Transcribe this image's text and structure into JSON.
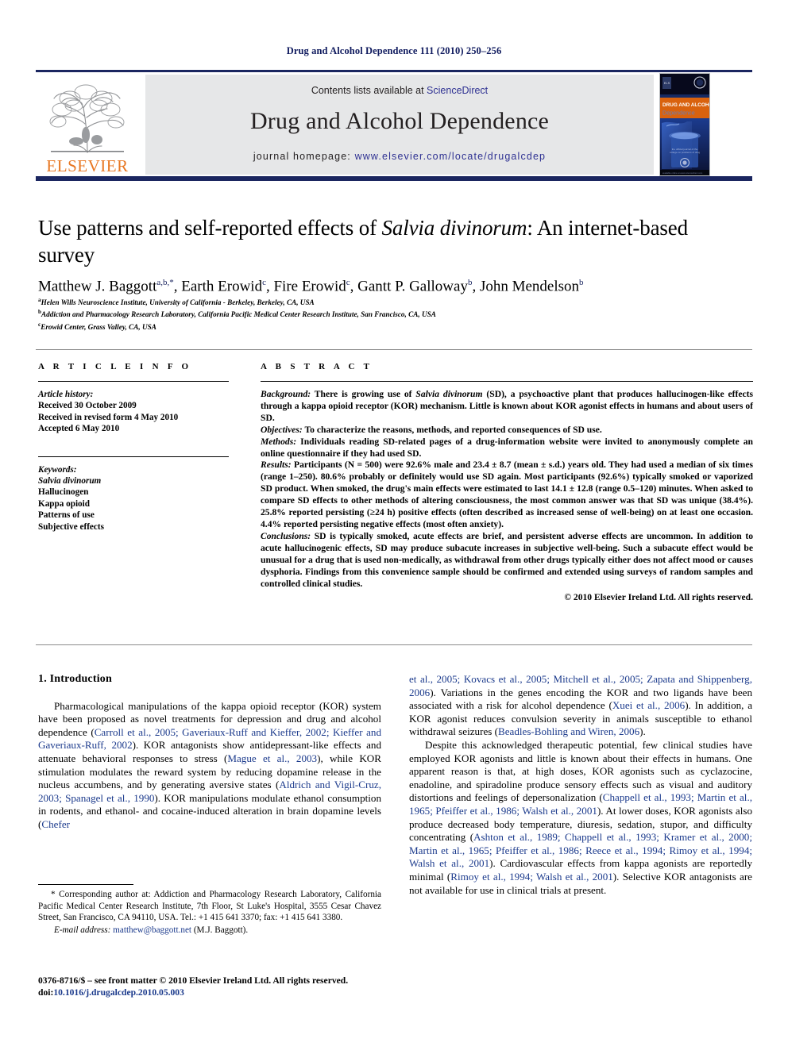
{
  "running_head": "Drug and Alcohol Dependence 111 (2010) 250–256",
  "masthead": {
    "contents_prefix": "Contents lists available at ",
    "sciencedirect": "ScienceDirect",
    "journal_name": "Drug and Alcohol Dependence",
    "homepage_prefix": "journal homepage: ",
    "homepage_url": "www.elsevier.com/locate/drugalcdep",
    "publisher": "ELSEVIER",
    "cover_title_line1": "DRUG AND ALCOHOL",
    "cover_title_line2": "Dependence",
    "accent_orange": "#e87722",
    "accent_blue": "#2e3192",
    "rule_color": "#1b2660",
    "band_bg": "#e6e7e8"
  },
  "article": {
    "title_part1": "Use patterns and self-reported effects of ",
    "title_italic": "Salvia divinorum",
    "title_part2": ": An internet-based survey",
    "authors": [
      {
        "name": "Matthew J. Baggott",
        "sup": "a,b,*"
      },
      {
        "name": "Earth Erowid",
        "sup": "c"
      },
      {
        "name": "Fire Erowid",
        "sup": "c"
      },
      {
        "name": "Gantt P. Galloway",
        "sup": "b"
      },
      {
        "name": "John Mendelson",
        "sup": "b"
      }
    ],
    "affiliations": [
      {
        "mark": "a",
        "text": "Helen Wills Neuroscience Institute, University of California - Berkeley, Berkeley, CA, USA"
      },
      {
        "mark": "b",
        "text": "Addiction and Pharmacology Research Laboratory, California Pacific Medical Center Research Institute, San Francisco, CA, USA"
      },
      {
        "mark": "c",
        "text": "Erowid Center, Grass Valley, CA, USA"
      }
    ]
  },
  "article_info": {
    "heading": "A R T I C L E   I N F O",
    "history_label": "Article history:",
    "history": [
      "Received 30 October 2009",
      "Received in revised form 4 May 2010",
      "Accepted 6 May 2010"
    ],
    "keywords_label": "Keywords:",
    "keywords": [
      "Salvia divinorum",
      "Hallucinogen",
      "Kappa opioid",
      "Patterns of use",
      "Subjective effects"
    ]
  },
  "abstract": {
    "heading": "A B S T R A C T",
    "background_label": "Background:",
    "background_text": " There is growing use of Salvia divinorum (SD), a psychoactive plant that produces hallucinogen-like effects through a kappa opioid receptor (KOR) mechanism. Little is known about KOR agonist effects in humans and about users of SD.",
    "objectives_label": "Objectives:",
    "objectives_text": " To characterize the reasons, methods, and reported consequences of SD use.",
    "methods_label": "Methods:",
    "methods_text": " Individuals reading SD-related pages of a drug-information website were invited to anonymously complete an online questionnaire if they had used SD.",
    "results_label": "Results:",
    "results_text": " Participants (N = 500) were 92.6% male and 23.4 ± 8.7 (mean ± s.d.) years old. They had used a median of six times (range 1–250). 80.6% probably or definitely would use SD again. Most participants (92.6%) typically smoked or vaporized SD product. When smoked, the drug's main effects were estimated to last 14.1 ± 12.8 (range 0.5–120) minutes. When asked to compare SD effects to other methods of altering consciousness, the most common answer was that SD was unique (38.4%). 25.8% reported persisting (≥24 h) positive effects (often described as increased sense of well-being) on at least one occasion. 4.4% reported persisting negative effects (most often anxiety).",
    "conclusions_label": "Conclusions:",
    "conclusions_text": " SD is typically smoked, acute effects are brief, and persistent adverse effects are uncommon. In addition to acute hallucinogenic effects, SD may produce subacute increases in subjective well-being. Such a subacute effect would be unusual for a drug that is used non-medically, as withdrawal from other drugs typically either does not affect mood or causes dysphoria. Findings from this convenience sample should be confirmed and extended using surveys of random samples and controlled clinical studies.",
    "copyright": "© 2010 Elsevier Ireland Ltd. All rights reserved."
  },
  "body": {
    "section_heading": "1. Introduction",
    "left_paragraph_1": {
      "segments": [
        {
          "t": "Pharmacological manipulations of the kappa opioid receptor (KOR) system have been proposed as novel treatments for depression and drug and alcohol dependence (",
          "ref": false
        },
        {
          "t": "Carroll et al., 2005; Gaveriaux-Ruff and Kieffer, 2002; Kieffer and Gaveriaux-Ruff, 2002",
          "ref": true
        },
        {
          "t": "). KOR antagonists show antidepressant-like effects and attenuate behavioral responses to stress (",
          "ref": false
        },
        {
          "t": "Mague et al., 2003",
          "ref": true
        },
        {
          "t": "), while KOR stimulation modulates the reward system by reducing dopamine release in the nucleus accumbens, and by generating aversive states (",
          "ref": false
        },
        {
          "t": "Aldrich and Vigil-Cruz, 2003; Spanagel et al., 1990",
          "ref": true
        },
        {
          "t": "). KOR manipulations modulate ethanol consumption in rodents, and ethanol- and cocaine-induced alteration in brain dopamine levels (",
          "ref": false
        },
        {
          "t": "Chefer",
          "ref": true
        }
      ]
    },
    "right_paragraph_1": {
      "segments": [
        {
          "t": "et al., 2005; Kovacs et al., 2005; Mitchell et al., 2005; Zapata and Shippenberg, 2006",
          "ref": true
        },
        {
          "t": "). Variations in the genes encoding the KOR and two ligands have been associated with a risk for alcohol dependence (",
          "ref": false
        },
        {
          "t": "Xuei et al., 2006",
          "ref": true
        },
        {
          "t": "). In addition, a KOR agonist reduces convulsion severity in animals susceptible to ethanol withdrawal seizures (",
          "ref": false
        },
        {
          "t": "Beadles-Bohling and Wiren, 2006",
          "ref": true
        },
        {
          "t": ").",
          "ref": false
        }
      ]
    },
    "right_paragraph_2": {
      "segments": [
        {
          "t": "Despite this acknowledged therapeutic potential, few clinical studies have employed KOR agonists and little is known about their effects in humans. One apparent reason is that, at high doses, KOR agonists such as cyclazocine, enadoline, and spiradoline produce sensory effects such as visual and auditory distortions and feelings of depersonalization (",
          "ref": false
        },
        {
          "t": "Chappell et al., 1993; Martin et al., 1965; Pfeiffer et al., 1986; Walsh et al., 2001",
          "ref": true
        },
        {
          "t": "). At lower doses, KOR agonists also produce decreased body temperature, diuresis, sedation, stupor, and difficulty concentrating (",
          "ref": false
        },
        {
          "t": "Ashton et al., 1989; Chappell et al., 1993; Kramer et al., 2000; Martin et al., 1965; Pfeiffer et al., 1986; Reece et al., 1994; Rimoy et al., 1994; Walsh et al., 2001",
          "ref": true
        },
        {
          "t": "). Cardiovascular effects from kappa agonists are reportedly minimal (",
          "ref": false
        },
        {
          "t": "Rimoy et al., 1994; Walsh et al., 2001",
          "ref": true
        },
        {
          "t": "). Selective KOR antagonists are not available for use in clinical trials at present.",
          "ref": false
        }
      ]
    }
  },
  "footnote": {
    "marker": "*",
    "text": " Corresponding author at: Addiction and Pharmacology Research Laboratory, California Pacific Medical Center Research Institute, 7th Floor, St Luke's Hospital, 3555 Cesar Chavez Street, San Francisco, CA 94110, USA. Tel.: +1 415 641 3370; fax: +1 415 641 3380.",
    "email_label": "E-mail address:",
    "email": "matthew@baggott.net",
    "email_suffix": " (M.J. Baggott)."
  },
  "imprint": {
    "line1": "0376-8716/$ – see front matter © 2010 Elsevier Ireland Ltd. All rights reserved.",
    "doi_label": "doi:",
    "doi": "10.1016/j.drugalcdep.2010.05.003"
  }
}
